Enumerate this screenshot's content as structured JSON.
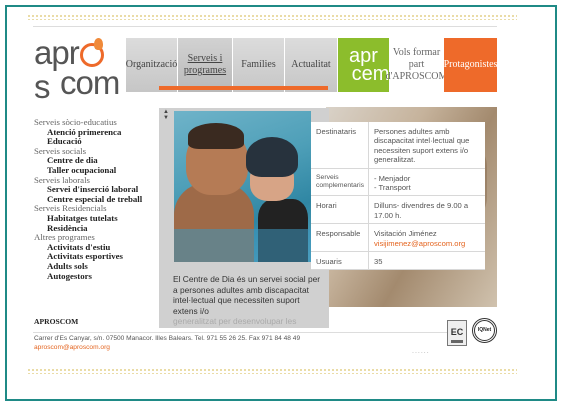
{
  "header": {
    "logo_line1": "apr",
    "logo_line1_end": "s",
    "logo_line2": "com"
  },
  "nav": {
    "organitzacio": "Organització",
    "serveis_line1": "Serveis i",
    "serveis_line2": "programes",
    "families": "Famílies",
    "actualitat": "Actualitat",
    "green_line1": "apr",
    "green_line2": "cem",
    "vols_line1": "Vols formar",
    "vols_line2": "part",
    "vols_line3": "d'APROSCOM",
    "protagonistes": "Protagonistes"
  },
  "sidebar": {
    "cat1": "Serveis sòcio-educatius",
    "cat1_items": [
      "Atenció primerenca",
      "Educació"
    ],
    "cat2": "Serveis socials",
    "cat2_items": [
      "Centre de dia",
      "Taller ocupacional"
    ],
    "cat3": "Serveis laborals",
    "cat3_items": [
      "Servei d'inserció laboral",
      "Centre especial de treball"
    ],
    "cat4": "Serveis Residencials",
    "cat4_items": [
      "Habitatges tutelats",
      "Residència"
    ],
    "cat5": "Altres programes",
    "cat5_items": [
      "Activitats d'estiu",
      "Activitats esportives",
      "Adults sols",
      "Autogestors"
    ]
  },
  "popup": {
    "text_main": "El Centre de Dia és un servei social per a persones adultes amb discapacitat intel·lectual que necessiten suport extens i/o",
    "text_faded": "generalitzat per desenvolupar les"
  },
  "info_table": {
    "destinataris_label": "Destinataris",
    "destinataris_value": "Persones adultes amb discapacitat intel·lectual que necessiten suport extens i/o generalitzat.",
    "serveis_label": "Serveis complementaris",
    "serveis_value1": "- Menjador",
    "serveis_value2": "- Transport",
    "horari_label": "Horari",
    "horari_value": "Dilluns- divendres de 9.00 a 17.00 h.",
    "responsable_label": "Responsable",
    "responsable_name": "Visitación Jiménez",
    "responsable_email": "visijimenez@aproscom.org",
    "usuaris_label": "Usuaris",
    "usuaris_value": "35"
  },
  "footer": {
    "title": "APROSCOM",
    "address": "Carrer d'Es Canyar, s/n. 07500 Manacor. Illes Balears. Tel. 971 55 26 25. Fax 971 84 48 49",
    "email": "aproscom@aproscom.org",
    "dots": "......",
    "ec_logo": "EC",
    "iqnet_logo": "IQNet"
  },
  "colors": {
    "accent_orange": "#ee6a2a",
    "accent_green": "#8cbd2c",
    "frame_teal": "#1f8a86"
  }
}
